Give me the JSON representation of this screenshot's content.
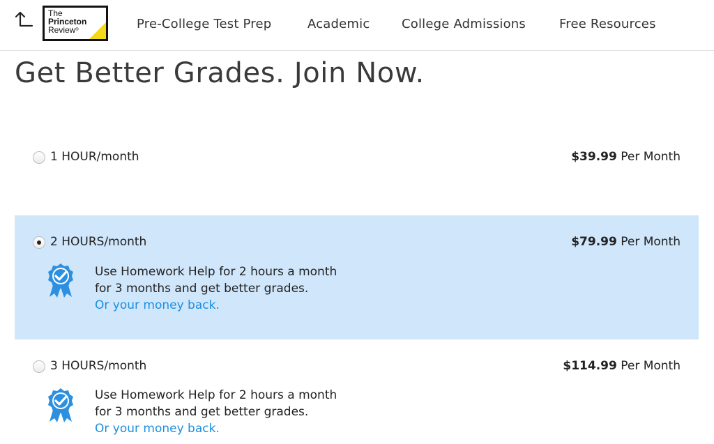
{
  "header": {
    "logo": {
      "line1": "The",
      "line2": "Princeton",
      "line3": "Review",
      "reg": "®"
    },
    "nav": [
      "Pre-College Test Prep",
      "Academic",
      "College Admissions",
      "Free Resources"
    ]
  },
  "headline": "Get Better Grades. Join Now.",
  "plans": [
    {
      "name": "1 HOUR/month",
      "price": "$39.99",
      "price_suffix": "Per Month",
      "selected": false
    },
    {
      "name": "2 HOURS/month",
      "price": "$79.99",
      "price_suffix": "Per Month",
      "selected": true,
      "desc_line1": "Use Homework Help for 2 hours a month",
      "desc_line2": "for 3 months and get better grades.",
      "guarantee": "Or your money back."
    },
    {
      "name": "3 HOURS/month",
      "price": "$114.99",
      "price_suffix": "Per Month",
      "selected": false,
      "desc_line1": "Use Homework Help for 2 hours a month",
      "desc_line2": "for 3 months and get better grades.",
      "guarantee": "Or your money back."
    }
  ],
  "colors": {
    "selected_bg": "#cfe6fb",
    "link": "#1a8fe0",
    "badge": "#2d8fe0",
    "logo_accent": "#f5d916"
  }
}
